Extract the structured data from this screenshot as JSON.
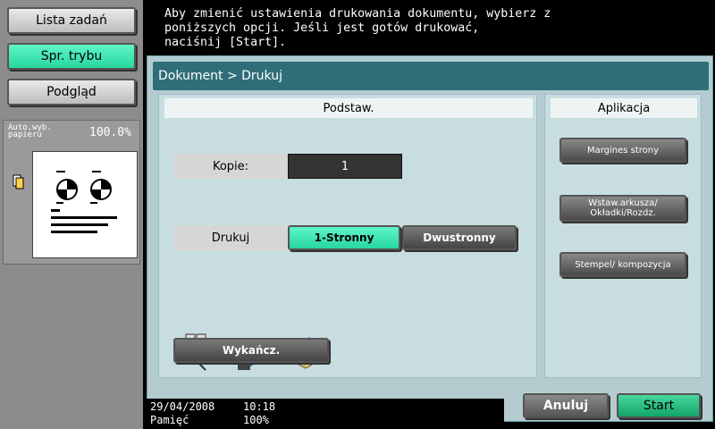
{
  "left": {
    "job_list": "Lista zadań",
    "mode_check": "Spr. trybu",
    "preview": "Podgląd",
    "paper_label": "Auto.wyb. papieru",
    "paper_percent": "100.0%"
  },
  "message": "Aby zmienić ustawienia drukowania dokumentu, wybierz z\nponiższych opcji. Jeśli jest gotów drukować,\nnaciśnij [Start].",
  "breadcrumb": "Dokument > Drukuj",
  "basic": {
    "title": "Podstaw.",
    "copies_label": "Kopie:",
    "copies_value": "1",
    "print_label": "Drukuj",
    "simplex": "1-Stronny",
    "duplex": "Dwustronny",
    "finishing": "Wykańcz."
  },
  "app": {
    "title": "Aplikacja",
    "margin": "Margines strony",
    "insert": "Wstaw.arkusza/ Okładki/Rozdz.",
    "stamp": "Stempel/ kompozycja"
  },
  "status": {
    "date": "29/04/2008",
    "time": "10:18",
    "memory_label": "Pamięć",
    "memory_value": "100%"
  },
  "buttons": {
    "cancel": "Anuluj",
    "start": "Start"
  },
  "colors": {
    "accent_green": "#27d79f",
    "start_green": "#13a46b",
    "header_teal": "#2f6e78"
  }
}
